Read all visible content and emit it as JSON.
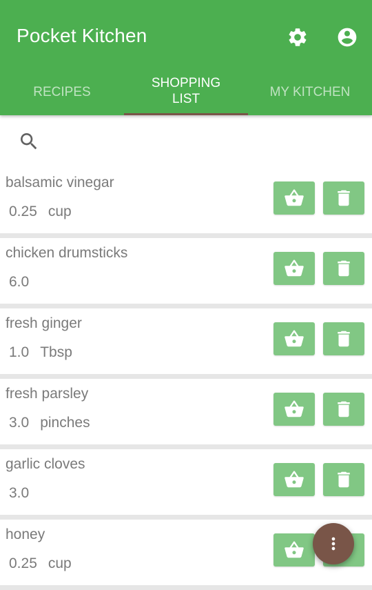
{
  "app": {
    "title": "Pocket Kitchen",
    "icons": {
      "settings": "gear-icon",
      "account": "account-circle-icon"
    },
    "colors": {
      "primary": "#4caf50",
      "accent": "#795548",
      "button": "#81c784"
    }
  },
  "tabs": [
    {
      "label": "RECIPES",
      "active": false
    },
    {
      "label": "SHOPPING LIST",
      "active": true
    },
    {
      "label": "MY KITCHEN",
      "active": false
    }
  ],
  "search": {
    "icon": "search-icon"
  },
  "items": [
    {
      "name": "balsamic vinegar",
      "amount": "0.25",
      "unit": "cup"
    },
    {
      "name": "chicken drumsticks",
      "amount": "6.0",
      "unit": ""
    },
    {
      "name": "fresh ginger",
      "amount": "1.0",
      "unit": "Tbsp"
    },
    {
      "name": "fresh parsley",
      "amount": "3.0",
      "unit": "pinches"
    },
    {
      "name": "garlic cloves",
      "amount": "3.0",
      "unit": ""
    },
    {
      "name": "honey",
      "amount": "0.25",
      "unit": "cup"
    }
  ],
  "fab": {
    "icon": "more-vert-icon"
  }
}
